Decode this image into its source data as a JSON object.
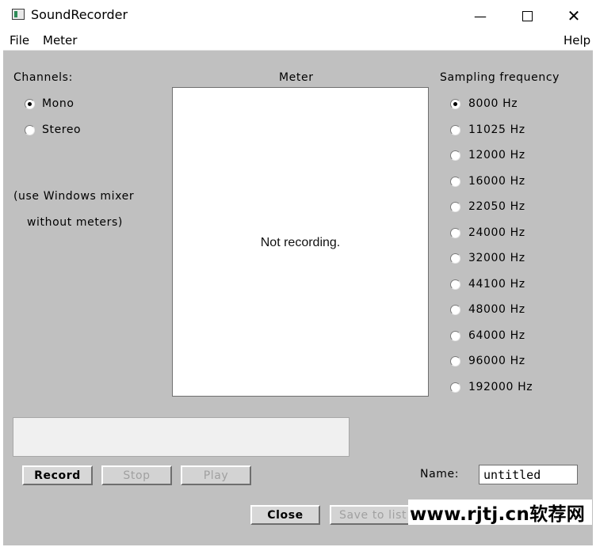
{
  "window": {
    "title": "SoundRecorder",
    "minimize_glyph": "—",
    "close_glyph": "✕"
  },
  "menu": {
    "file": "File",
    "meter": "Meter",
    "help": "Help"
  },
  "channels": {
    "heading": "Channels:",
    "options": [
      {
        "label": "Mono",
        "selected": true
      },
      {
        "label": "Stereo",
        "selected": false
      }
    ],
    "note_line1": "(use Windows mixer",
    "note_line2": "without meters)"
  },
  "meter": {
    "heading": "Meter",
    "status": "Not recording."
  },
  "sampling": {
    "heading": "Sampling frequency",
    "options": [
      {
        "label": "8000 Hz",
        "selected": true
      },
      {
        "label": "11025 Hz",
        "selected": false
      },
      {
        "label": "12000 Hz",
        "selected": false
      },
      {
        "label": "16000 Hz",
        "selected": false
      },
      {
        "label": "22050 Hz",
        "selected": false
      },
      {
        "label": "24000 Hz",
        "selected": false
      },
      {
        "label": "32000 Hz",
        "selected": false
      },
      {
        "label": "44100 Hz",
        "selected": false
      },
      {
        "label": "48000 Hz",
        "selected": false
      },
      {
        "label": "64000 Hz",
        "selected": false
      },
      {
        "label": "96000 Hz",
        "selected": false
      },
      {
        "label": "192000 Hz",
        "selected": false
      }
    ]
  },
  "controls": {
    "record": "Record",
    "stop": "Stop",
    "play": "Play",
    "name_label": "Name:",
    "name_value": "untitled",
    "close": "Close",
    "save_to_list": "Save to list"
  },
  "watermark": "www.rjtj.cn软荐网",
  "colors": {
    "client_bg": "#c0c0c0",
    "meter_bg": "#ffffff"
  }
}
